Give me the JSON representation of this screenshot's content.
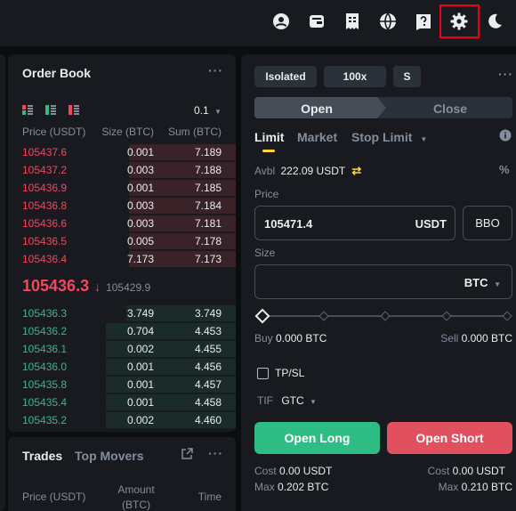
{
  "topbar": {
    "icons": [
      "user-icon",
      "wallet-icon",
      "orders-icon",
      "globe-icon",
      "help-icon",
      "settings-icon",
      "theme-moon-icon"
    ]
  },
  "order_book": {
    "title": "Order Book",
    "tick_size": "0.1",
    "columns": [
      "Price (USDT)",
      "Size (BTC)",
      "Sum (BTC)"
    ],
    "asks": [
      {
        "price": "105437.6",
        "size": "0.001",
        "sum": "7.189",
        "depth": 0.47
      },
      {
        "price": "105437.2",
        "size": "0.003",
        "sum": "7.188",
        "depth": 0.47
      },
      {
        "price": "105436.9",
        "size": "0.001",
        "sum": "7.185",
        "depth": 0.47
      },
      {
        "price": "105436.8",
        "size": "0.003",
        "sum": "7.184",
        "depth": 0.47
      },
      {
        "price": "105436.6",
        "size": "0.003",
        "sum": "7.181",
        "depth": 0.47
      },
      {
        "price": "105436.5",
        "size": "0.005",
        "sum": "7.178",
        "depth": 0.47
      },
      {
        "price": "105436.4",
        "size": "7.173",
        "sum": "7.173",
        "depth": 0.47
      }
    ],
    "last_price": "105436.3",
    "mark_price": "105429.9",
    "bids": [
      {
        "price": "105436.3",
        "size": "3.749",
        "sum": "3.749",
        "depth": 0.48
      },
      {
        "price": "105436.2",
        "size": "0.704",
        "sum": "4.453",
        "depth": 0.57
      },
      {
        "price": "105436.1",
        "size": "0.002",
        "sum": "4.455",
        "depth": 0.57
      },
      {
        "price": "105436.0",
        "size": "0.001",
        "sum": "4.456",
        "depth": 0.57
      },
      {
        "price": "105435.8",
        "size": "0.001",
        "sum": "4.457",
        "depth": 0.57
      },
      {
        "price": "105435.4",
        "size": "0.001",
        "sum": "4.458",
        "depth": 0.57
      },
      {
        "price": "105435.2",
        "size": "0.002",
        "sum": "4.460",
        "depth": 0.57
      }
    ]
  },
  "trades": {
    "tabs": [
      "Trades",
      "Top Movers"
    ],
    "columns": [
      "Price (USDT)",
      "Amount (BTC)",
      "Time"
    ]
  },
  "order_form": {
    "margin_mode": "Isolated",
    "leverage": "100x",
    "asset_mode": "S",
    "open_label": "Open",
    "close_label": "Close",
    "order_types": [
      "Limit",
      "Market",
      "Stop Limit"
    ],
    "avbl_label": "Avbl",
    "avbl_value": "222.09 USDT",
    "price_label": "Price",
    "price_value": "105471.4",
    "price_unit": "USDT",
    "bbo_label": "BBO",
    "size_label": "Size",
    "size_value": "",
    "size_unit": "BTC",
    "slider_level": 0,
    "buy_label": "Buy",
    "buy_value": "0.000 BTC",
    "sell_label": "Sell",
    "sell_value": "0.000 BTC",
    "tpsl_label": "TP/SL",
    "tif_label": "TIF",
    "tif_value": "GTC",
    "open_long_label": "Open Long",
    "open_short_label": "Open Short",
    "cost_label": "Cost",
    "cost_long": "0.00 USDT",
    "cost_short": "0.00 USDT",
    "max_label": "Max",
    "max_long": "0.202 BTC",
    "max_short": "0.210 BTC"
  },
  "colors": {
    "buy": "#2ebd85",
    "sell": "#f6465d",
    "long_button": "#2ebd85",
    "short_button": "#e0505e",
    "accent": "#fcd535",
    "highlight_frame": "#e8001c"
  }
}
